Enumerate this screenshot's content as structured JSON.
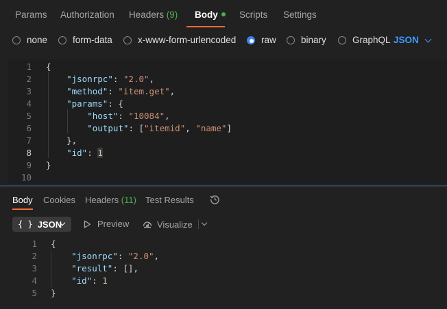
{
  "request_tabs": [
    {
      "label": "Params"
    },
    {
      "label": "Authorization"
    },
    {
      "label": "Headers",
      "count": "(9)"
    },
    {
      "label": "Body"
    },
    {
      "label": "Scripts"
    },
    {
      "label": "Settings"
    }
  ],
  "body_types": [
    "none",
    "form-data",
    "x-www-form-urlencoded",
    "raw",
    "binary",
    "GraphQL"
  ],
  "body_type_selected": "raw",
  "raw_format": "JSON",
  "request_line_numbers": [
    "1",
    "2",
    "3",
    "4",
    "5",
    "6",
    "7",
    "8",
    "9",
    "10"
  ],
  "request_code": {
    "jsonrpc_key": "\"jsonrpc\"",
    "jsonrpc_val": "\"2.0\"",
    "method_key": "\"method\"",
    "method_val": "\"item.get\"",
    "params_key": "\"params\"",
    "host_key": "\"host\"",
    "host_val": "\"10084\"",
    "output_key": "\"output\"",
    "output_val1": "\"itemid\"",
    "output_val2": "\"name\"",
    "id_key": "\"id\"",
    "id_val": "1"
  },
  "response_tabs": [
    {
      "label": "Body"
    },
    {
      "label": "Cookies"
    },
    {
      "label": "Headers",
      "count": "(11)"
    },
    {
      "label": "Test Results"
    }
  ],
  "response_toolbar": {
    "format_braces": "{ }",
    "format_label": "JSON",
    "preview_label": "Preview",
    "visualize_label": "Visualize"
  },
  "response_line_numbers": [
    "1",
    "2",
    "3",
    "4",
    "5"
  ],
  "response_code": {
    "jsonrpc_key": "\"jsonrpc\"",
    "jsonrpc_val": "\"2.0\"",
    "result_key": "\"result\"",
    "result_val": "[]",
    "id_key": "\"id\"",
    "id_val": "1"
  },
  "colors": {
    "accent_orange": "#ff6c37",
    "selection_blue": "#3b82f6",
    "count_green": "#4caf50",
    "json_key": "#9cdcfe",
    "json_string": "#ce9178",
    "json_number": "#b5cea8"
  },
  "icons": [
    "radio-icon",
    "chevron-down-icon",
    "history-icon",
    "play-icon",
    "visualize-icon"
  ]
}
